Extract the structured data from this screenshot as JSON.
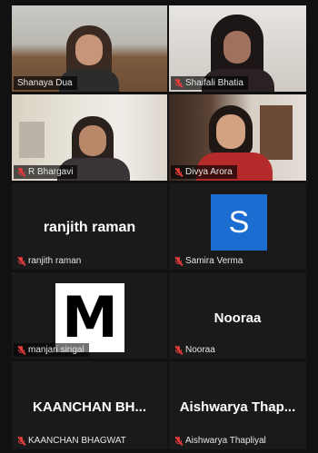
{
  "participants": [
    {
      "name": "Shanaya Dua",
      "display": "",
      "type": "video",
      "active": true,
      "muted": false
    },
    {
      "name": "Shaifali Bhatia",
      "display": "",
      "type": "video",
      "active": false,
      "muted": true
    },
    {
      "name": "R Bhargavi",
      "display": "",
      "type": "video",
      "active": false,
      "muted": true
    },
    {
      "name": "Divya Arora",
      "display": "",
      "type": "video",
      "active": false,
      "muted": true
    },
    {
      "name": "ranjith raman",
      "display": "ranjith raman",
      "type": "name",
      "active": false,
      "muted": true
    },
    {
      "name": "Samira Verma",
      "display": "S",
      "type": "avatar-letter",
      "active": false,
      "muted": true
    },
    {
      "name": "manjari singal",
      "display": "M",
      "type": "avatar-image",
      "active": false,
      "muted": true
    },
    {
      "name": "Nooraa",
      "display": "Nooraa",
      "type": "name",
      "active": false,
      "muted": true
    },
    {
      "name": "KAANCHAN BHAGWAT",
      "display": "KAANCHAN BH...",
      "type": "name",
      "active": false,
      "muted": true
    },
    {
      "name": "Aishwarya Thapliyal",
      "display": "Aishwarya Thap...",
      "type": "name",
      "active": false,
      "muted": true
    }
  ],
  "colors": {
    "active_speaker_border": "#e7e600",
    "mic_muted": "#e43b3b",
    "avatar_blue": "#1b6dd1",
    "tile_bg": "#1a1a1a"
  },
  "icons": {
    "muted": "mic-off-icon"
  }
}
